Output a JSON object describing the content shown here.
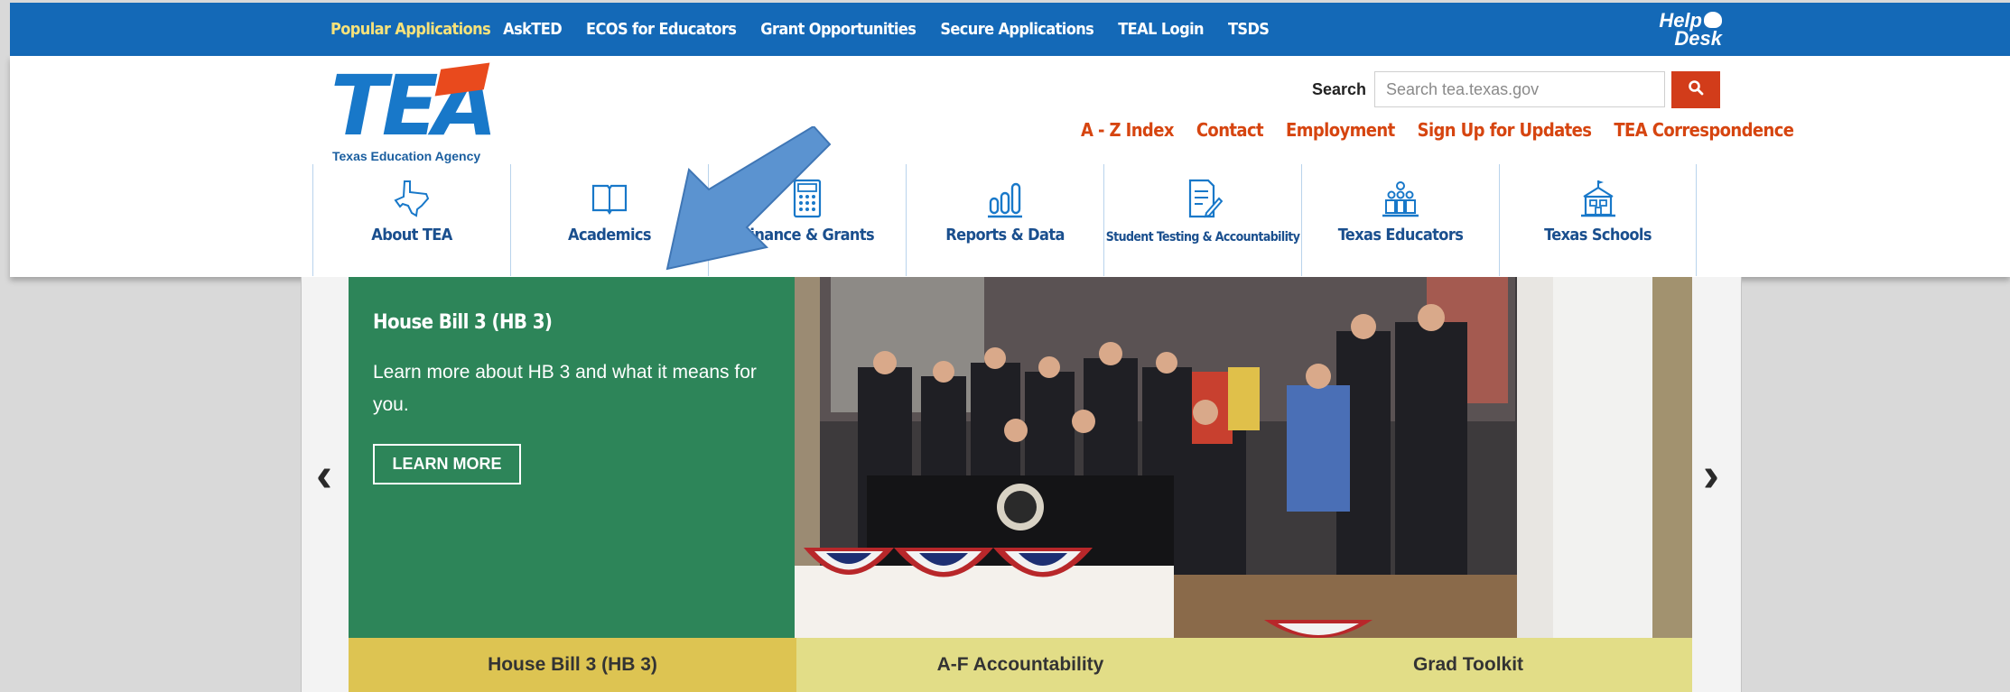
{
  "topbar": {
    "links": [
      "Popular Applications",
      "AskTED",
      "ECOS for Educators",
      "Grant Opportunities",
      "Secure Applications",
      "TEAL Login",
      "TSDS"
    ],
    "helpdesk_line1": "Help",
    "helpdesk_line2": "Desk"
  },
  "header": {
    "logo_text": "TEA",
    "logo_subtitle": "Texas Education Agency",
    "search_label": "Search",
    "search_placeholder": "Search tea.texas.gov",
    "search_button_icon": "magnifier-icon",
    "util_links": [
      "A - Z Index",
      "Contact",
      "Employment",
      "Sign Up for Updates",
      "TEA Correspondence"
    ]
  },
  "mainnav": {
    "items": [
      {
        "label": "About TEA",
        "icon": "texas-outline-icon"
      },
      {
        "label": "Academics",
        "icon": "open-book-icon"
      },
      {
        "label": "Finance & Grants",
        "icon": "calculator-icon"
      },
      {
        "label": "Reports & Data",
        "icon": "bar-chart-icon"
      },
      {
        "label": "Student Testing & Accountability",
        "icon": "test-paper-icon"
      },
      {
        "label": "Texas Educators",
        "icon": "classroom-icon"
      },
      {
        "label": "Texas Schools",
        "icon": "schoolhouse-icon"
      }
    ]
  },
  "carousel": {
    "slide_title": "House Bill 3 (HB 3)",
    "slide_description": "Learn more about HB 3 and what it means for you.",
    "button_label": "LEARN MORE",
    "prev_arrow": "‹",
    "next_arrow": "›",
    "tabs": [
      "House Bill 3 (HB 3)",
      "A-F Accountability",
      "Grad Toolkit"
    ]
  },
  "colors": {
    "topbar": "#1469b7",
    "accent_orange": "#d64510",
    "slide_green": "#2d8559",
    "tab_active": "#ddc452",
    "tab_inactive": "#e2dd87"
  }
}
